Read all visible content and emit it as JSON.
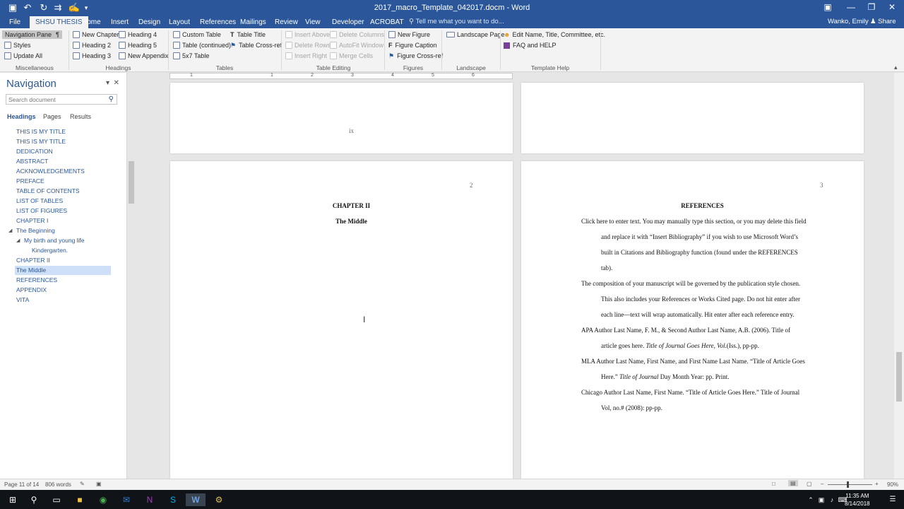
{
  "window": {
    "title": "2017_macro_Template_042017.docm - Word",
    "user": "Wanko, Emily",
    "share": "Share"
  },
  "tabs": [
    "File",
    "SHSU THESIS",
    "Home",
    "Insert",
    "Design",
    "Layout",
    "References",
    "Mailings",
    "Review",
    "View",
    "Developer",
    "ACROBAT"
  ],
  "tell_me": "Tell me what you want to do...",
  "ribbon": {
    "misc": {
      "nav_pane": "Navigation Pane",
      "styles": "Styles",
      "update_all": "Update All",
      "label": "Miscellaneous"
    },
    "headings": {
      "new_chapter": "New Chapter",
      "heading2": "Heading 2",
      "heading3": "Heading 3",
      "heading4": "Heading 4",
      "heading5": "Heading 5",
      "new_appendix": "New Appendix",
      "label": "Headings"
    },
    "tables": {
      "custom": "Custom Table",
      "continued": "Table (continued)",
      "five_by_seven": "5x7 Table",
      "title": "Table Title",
      "cross_ref": "Table Cross-ref",
      "label": "Tables"
    },
    "table_editing": {
      "insert_above": "Insert Above",
      "delete_rows": "Delete Rows",
      "insert_right": "Insert Right",
      "delete_columns": "Delete Columns",
      "autofit": "AutoFit Window",
      "merge": "Merge Cells",
      "label": "Table Editing"
    },
    "figures": {
      "new_figure": "New Figure",
      "caption": "Figure Caption",
      "cross_ref": "Figure Cross-ref",
      "label": "Figures"
    },
    "landscape": {
      "page": "Landscape Page",
      "label": "Landscape"
    },
    "help": {
      "edit_name": "Edit Name, Title, Committee, etc.",
      "faq": "FAQ and HELP",
      "label": "Template Help"
    }
  },
  "navigation": {
    "title": "Navigation",
    "search_placeholder": "Search document",
    "tabs": [
      "Headings",
      "Pages",
      "Results"
    ],
    "headings": [
      "THIS IS MY TITLE",
      "THIS IS MY TITLE",
      "DEDICATION",
      "ABSTRACT",
      "ACKNOWLEDGEMENTS",
      "PREFACE",
      "TABLE OF CONTENTS",
      "LIST OF TABLES",
      "LIST OF FIGURES",
      "CHAPTER I",
      "The Beginning",
      "My birth and young life",
      "Kindergarten.",
      "CHAPTER II",
      "The Middle",
      "REFERENCES",
      "APPENDIX",
      "VITA"
    ]
  },
  "ruler_numbers": [
    "1",
    "1",
    "2",
    "3",
    "4",
    "5",
    "6"
  ],
  "pages": {
    "top_left_number": "ix",
    "left": {
      "number": "2",
      "chapter": "CHAPTER II",
      "subtitle": "The Middle"
    },
    "right": {
      "number": "3",
      "heading": "REFERENCES",
      "lines": [
        "Click here to enter text. You may manually type this section, or you may delete this field",
        "and replace it with “Insert Bibliography” if you wish to use Microsoft Word’s",
        "built in Citations and Bibliography function (found under the REFERENCES",
        "tab).",
        "The composition of your manuscript will be governed by the publication style chosen.",
        "This also includes your References or Works Cited page. Do not hit enter after",
        "each line—text will wrap automatically. Hit enter after each reference entry.",
        "APA Author Last Name, F. M., & Second Author Last Name, A.B. (2006). Title of",
        "MLA Author Last Name, First Name, and First Name Last Name. “Title of Article Goes",
        "Chicago Author Last Name, First Name. “Title of Article Goes Here.” Title of Journal",
        "Vol, no.# (2008): pp-pp."
      ],
      "apa2": {
        "a": "article goes here. ",
        "i": "Title of Journal Goes Here, Vol.",
        "b": "(Iss.), pp-pp."
      },
      "mla2": {
        "a": "Here.” ",
        "i": "Title of Journal",
        "b": " Day Month Year: pp. Print."
      }
    }
  },
  "status": {
    "page": "Page 11 of 14",
    "words": "806 words",
    "zoom": "90%"
  },
  "clock": {
    "time": "11:35 AM",
    "date": "8/14/2018"
  },
  "colors": {
    "accent": "#2b579a",
    "taskbar": "#101418",
    "nav_selected": "#cde0f7"
  }
}
